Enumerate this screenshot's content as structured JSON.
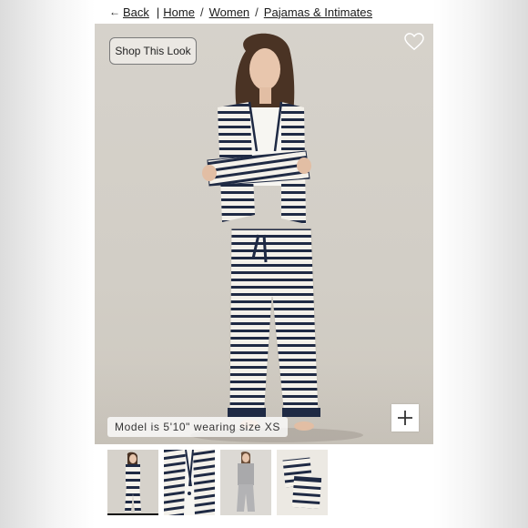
{
  "breadcrumb": {
    "back_label": "Back",
    "items": [
      "Home",
      "Women",
      "Pajamas & Intimates"
    ]
  },
  "hero": {
    "shop_button_label": "Shop This Look",
    "model_caption": "Model is 5'10\" wearing size XS",
    "icons": {
      "favorite": "heart-outline-icon",
      "zoom": "plus-icon"
    }
  },
  "thumbnails": [
    {
      "alt": "full-length front view",
      "selected": true
    },
    {
      "alt": "close-up of striped top"
    },
    {
      "alt": "heather grey pajama set"
    },
    {
      "alt": "folded striped pajamas"
    }
  ],
  "colors": {
    "stripe_navy": "#1f2a44",
    "fabric_ivory": "#f4f1ea",
    "backdrop": "#d4d0c9"
  }
}
